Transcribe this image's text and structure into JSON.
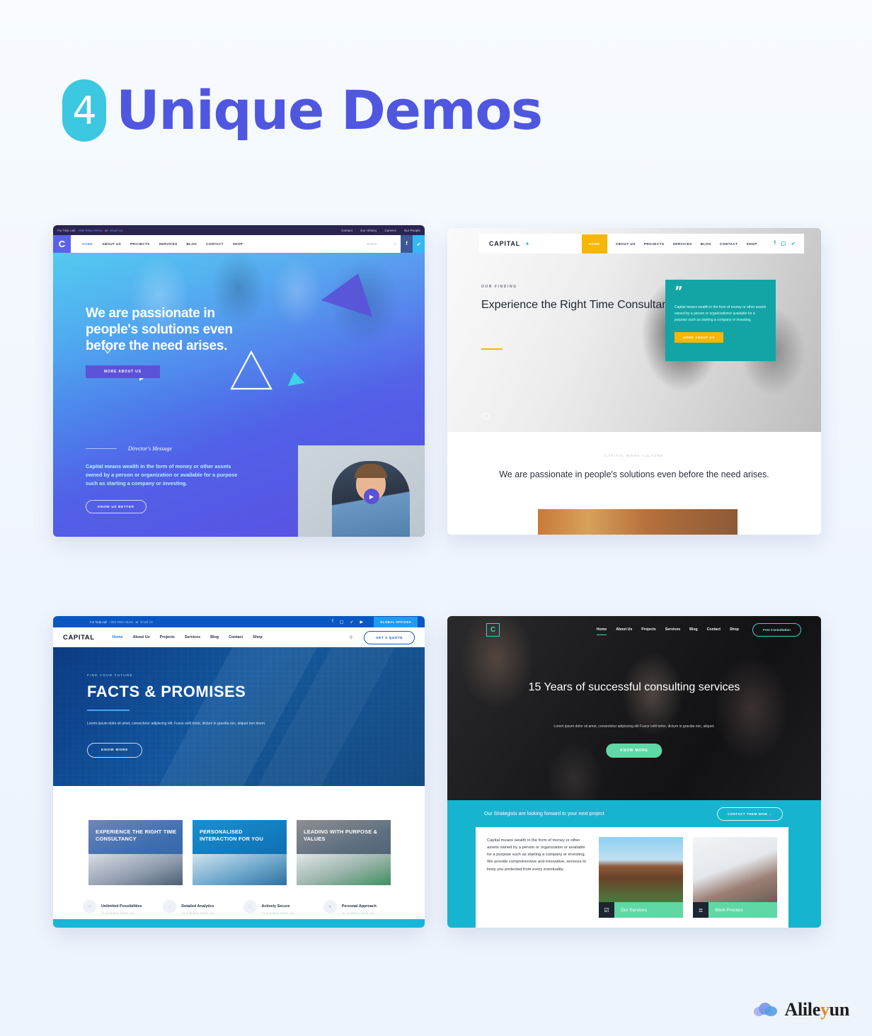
{
  "header": {
    "badge_number": "4",
    "title": "Unique Demos",
    "accent_badge": "#3bc8e0",
    "accent_title": "#4f56e0"
  },
  "demo1": {
    "topbar": {
      "help_label": "For help call",
      "phone": "+080 9081 09191",
      "or": "or",
      "email_link": "Email Us",
      "links": [
        "Contact",
        "Our History",
        "Careers",
        "Our People"
      ]
    },
    "nav": {
      "logo": "C",
      "items": [
        "HOME",
        "ABOUT US",
        "PROJECTS",
        "SERVICES",
        "BLOG",
        "CONTACT",
        "SHOP"
      ],
      "active": "HOME",
      "search_placeholder": "Search",
      "social": [
        "f",
        "t"
      ]
    },
    "hero": {
      "heading": "We are passionate in people's solutions even before the need arises.",
      "button": "MORE ABOUT US"
    },
    "director": {
      "label": "Director's Message",
      "paragraph": "Capital means wealth in the form of money or other assets owned by a person or organization or available for a purpose such as starting a company or investing.",
      "button": "KNOW US BETTER"
    }
  },
  "demo2": {
    "nav": {
      "logo": "CAPITAL",
      "items": [
        "HOME",
        "ABOUT US",
        "PROJECTS",
        "SERVICES",
        "BLOG",
        "CONTACT",
        "SHOP"
      ],
      "active": "HOME"
    },
    "hero": {
      "eyebrow": "OUR FINDING",
      "heading": "Experience the Right Time Consultancy"
    },
    "quote_card": {
      "quote_mark": "”",
      "text": "Capital means wealth in the form of money or other assets owned by a person or organizationor available for a purpose such as starting a company or investing.",
      "button": "MORE ABOUT US"
    },
    "section": {
      "label": "CAPITAL WORK CULTURE",
      "heading": "We are passionate in people's solutions even before the need arises."
    }
  },
  "demo3": {
    "topbar": {
      "help_label": "For help-call",
      "phone": "+080 9081 09191",
      "or": "or",
      "email_link": "Email Us",
      "offices_button": "GLOBAL OFFICES"
    },
    "nav": {
      "logo": "CAPITAL",
      "items": [
        "Home",
        "About Us",
        "Projects",
        "Services",
        "Blog",
        "Contact",
        "Shop"
      ],
      "active": "Home",
      "quote_button": "GET A QUOTE"
    },
    "hero": {
      "eyebrow": "FIND YOUR FUTURE",
      "heading": "FACTS & PROMISES",
      "paragraph": "Lorem ipsum dolor sit amet, consectetur adipiscing elit. Fusce velit tortor, dictum in gravida nec, aliquet non lorem.",
      "button": "KNOW MORE"
    },
    "cards": [
      {
        "title": "EXPERIENCE THE RIGHT TIME CONSULTANCY"
      },
      {
        "title": "PERSONALISED INTERACTION FOR YOU"
      },
      {
        "title": "LEADING WITH PURPOSE & VALUES"
      }
    ],
    "features": [
      {
        "icon": "infinity-icon",
        "glyph": "∞",
        "title": "Unlimited Possibilities",
        "subtitle": "Ut ut finibus tortor, eu"
      },
      {
        "icon": "analytics-icon",
        "glyph": "∴",
        "title": "Detailed Analytics",
        "subtitle": "Ut ut finibus tortor, eu"
      },
      {
        "icon": "lock-icon",
        "glyph": "□",
        "title": "Actively Secure",
        "subtitle": "Ut ut finibus tortor, eu"
      },
      {
        "icon": "person-icon",
        "glyph": "●",
        "title": "Personal Approach",
        "subtitle": "Ut ut finibus tortor, eu"
      }
    ]
  },
  "demo4": {
    "nav": {
      "logo": "C",
      "items": [
        "Home",
        "About Us",
        "Projects",
        "Services",
        "Blog",
        "Contact",
        "Shop"
      ],
      "active": "Home",
      "cta_button": "Free Consultation"
    },
    "hero": {
      "heading": "15 Years of successful consulting services",
      "paragraph": "Lorem ipsum dolor sit amet, consectetur adipiscing elit Fusce velit tortor, dictum in gravida nec, aliquet.",
      "button": "KNOW MORE"
    },
    "cta": {
      "text": "Our Strategists are looking forward to your next project",
      "button": "CONTACT THEM NOW  →"
    },
    "panel": {
      "text": "Capital means wealth in the form of money or other assets owned by a person or organization or available for a purpose such as starting a company or investing. We provide comprehensive and innovative, services to keep you protected from every eventuality.",
      "tiles": [
        {
          "label": "Our Services",
          "icon": "clipboard-icon",
          "glyph": "☑"
        },
        {
          "label": "Work Process",
          "icon": "list-icon",
          "glyph": "≣"
        }
      ]
    }
  },
  "footer": {
    "brand_prefix": "Alile",
    "brand_accent": "y",
    "brand_suffix": "un",
    "accent_color": "#e08b1f"
  }
}
